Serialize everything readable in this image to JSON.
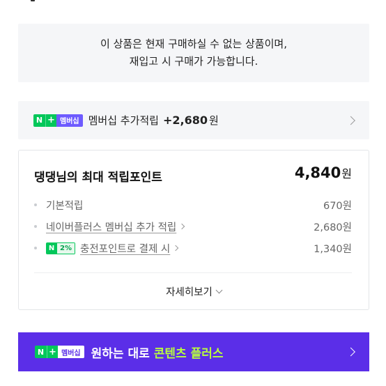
{
  "notice": {
    "line1": "이 상품은 현재 구매하실 수 없는 상품이며,",
    "line2": "재입고 시 구매가 가능합니다."
  },
  "membership": {
    "badge_n": "N",
    "badge_plus": "+",
    "badge_label": "멤버십",
    "text": "멤버십 추가적립",
    "amount": "+2,680",
    "unit": "원"
  },
  "points": {
    "title": "댕댕님의 최대 적립포인트",
    "total": "4,840",
    "total_unit": "원",
    "rows": [
      {
        "label": "기본적립",
        "value": "670원"
      },
      {
        "label": "네이버플러스 멤버십 추가 적립",
        "value": "2,680원"
      },
      {
        "badge_n": "N",
        "badge_pct": "2%",
        "label": "충전포인트로 결제 시",
        "value": "1,340원"
      }
    ],
    "detail_label": "자세히보기"
  },
  "promo": {
    "badge_n": "N",
    "badge_plus": "+",
    "badge_label": "멤버십",
    "text": "원하는 대로",
    "highlight": "콘텐츠 플러스"
  },
  "colors": {
    "naver_green": "#03c75a",
    "membership_purple": "#6e5bff",
    "promo_bg": "#5b2ee8",
    "promo_highlight": "#b8ff3d"
  }
}
